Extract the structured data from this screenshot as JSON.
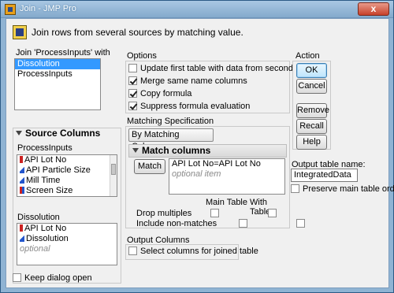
{
  "window": {
    "title": "Join - JMP Pro",
    "close_label": "x"
  },
  "header": {
    "text": "Join rows from several sources by matching value."
  },
  "join_with": {
    "label": "Join 'ProcessInputs' with",
    "items": [
      "Dissolution",
      "ProcessInputs"
    ],
    "selected": "Dissolution"
  },
  "source_columns": {
    "title": "Source Columns",
    "processinputs": {
      "label": "ProcessInputs",
      "columns": [
        "API Lot No",
        "API Particle Size",
        "Mill Time",
        "Screen Size"
      ]
    },
    "dissolution": {
      "label": "Dissolution",
      "columns": [
        "API Lot No",
        "Dissolution"
      ],
      "placeholder": "optional"
    }
  },
  "options": {
    "label": "Options",
    "items": [
      {
        "label": "Update first table with data from second table",
        "checked": false
      },
      {
        "label": "Merge same name columns",
        "checked": true
      },
      {
        "label": "Copy formula",
        "checked": true
      },
      {
        "label": "Suppress formula evaluation",
        "checked": true
      }
    ]
  },
  "matching": {
    "label": "Matching Specification",
    "dropdown": "By Matching Columns",
    "match_columns_title": "Match columns",
    "match_button": "Match",
    "pairs": [
      "API Lot No=API Lot No"
    ],
    "placeholder": "optional item",
    "col_main": "Main Table",
    "col_with": "With Table",
    "drop_multiples": "Drop multiples",
    "include_nonmatches": "Include non-matches"
  },
  "output_columns": {
    "label": "Output Columns",
    "select_label": "Select columns for joined table"
  },
  "action": {
    "label": "Action",
    "ok": "OK",
    "cancel": "Cancel",
    "remove": "Remove",
    "recall": "Recall",
    "help": "Help"
  },
  "output": {
    "label": "Output table name:",
    "value": "IntegratedData",
    "preserve_label": "Preserve main table order"
  },
  "keep_open": {
    "label": "Keep dialog open"
  }
}
